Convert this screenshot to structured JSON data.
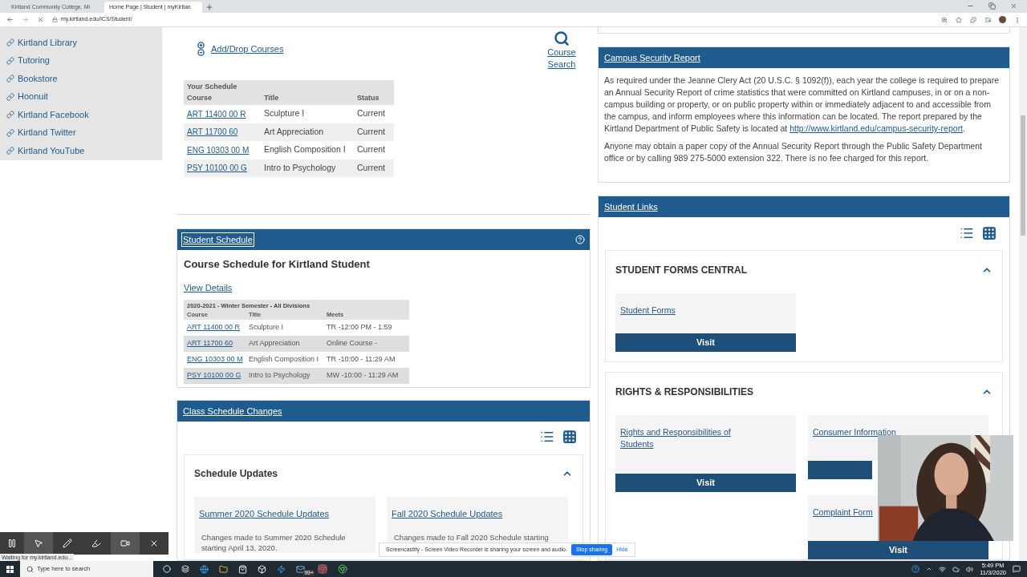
{
  "browser": {
    "tabs": [
      {
        "title": "Kirtland Community College, Mi",
        "selected": false
      },
      {
        "title": "Home Page | Student | myKirtlan",
        "selected": true
      }
    ],
    "url": "my.kirtland.edu/ICS/Student/"
  },
  "sidebar": {
    "links": [
      "Kirtland Library",
      "Tutoring",
      "Bookstore",
      "Hoonuit",
      "Kirtland Facebook",
      "Kirtland Twitter",
      "Kirtland YouTube"
    ]
  },
  "quick_links": {
    "add_drop": "Add/Drop Courses",
    "course_search": "Course Search"
  },
  "your_schedule": {
    "caption": "Your Schedule",
    "columns": [
      "Course",
      "Title",
      "Status"
    ],
    "rows": [
      {
        "course": "ART 11400 00 R",
        "title": "Sculpture I",
        "status": "Current"
      },
      {
        "course": "ART 11700 60",
        "title": "Art Appreciation",
        "status": "Current"
      },
      {
        "course": "ENG 10303 00 M",
        "title": "English Composition I",
        "status": "Current"
      },
      {
        "course": "PSY 10100 00 G",
        "title": "Intro to Psychology",
        "status": "Current"
      }
    ]
  },
  "student_schedule": {
    "header": "Student Schedule",
    "heading": "Course Schedule for Kirtland Student",
    "view_details": "View Details",
    "caption": "2020-2021 - Winter Semester - All Divisions",
    "columns": [
      "Course",
      "Title",
      "Meets"
    ],
    "rows": [
      {
        "course": "ART 11400 00 R",
        "title": "Sculpture I",
        "meets": "TR -12:00 PM - 1:59"
      },
      {
        "course": "ART 11700 60",
        "title": "Art Appreciation",
        "meets": "Online Course -"
      },
      {
        "course": "ENG 10303 00 M",
        "title": "English Composition I",
        "meets": "TR -10:00 - 11:29 AM"
      },
      {
        "course": "PSY 10100 00 G",
        "title": "Intro to Psychology",
        "meets": "MW -10:00 - 11:29 AM"
      }
    ]
  },
  "class_schedule_changes": {
    "header": "Class Schedule Changes",
    "section": {
      "title": "Schedule Updates",
      "expanded": true,
      "items": [
        {
          "link": "Summer 2020 Schedule Updates",
          "text": "Changes made to Summer 2020 Schedule starting April 13, 2020."
        },
        {
          "link": "Fall 2020 Schedule Updates",
          "text": "Changes made to Fall 2020 Schedule starting"
        }
      ]
    }
  },
  "campus_security": {
    "header": "Campus Security Report",
    "p1": "As required under the Jeanne Clery Act (20 U.S.C. § 1092(f)), each year the college is required to prepare an Annual Security Report of crime statistics that were committed on Kirtland campuses, in or on a non-campus building or property, or on public property within or immediately adjacent to and accessible from the campus, and inform employees where this information can be located. The report prepared by the Kirtland Department of Public Safety is located at ",
    "link": "http://www.kirtland.edu/campus-security-report",
    "p1_end": ".",
    "p2": "Anyone may obtain a paper copy of the Annual Security Report through the Public Safety Department office or by calling 989 275-5000 extension 322. There is no fee charged for this report."
  },
  "student_links": {
    "header": "Student Links",
    "sections": [
      {
        "title": "STUDENT FORMS CENTRAL",
        "expanded": true,
        "tiles": [
          {
            "link": "Student Forms",
            "button": "Visit"
          }
        ]
      },
      {
        "title": "RIGHTS & RESPONSIBILITIES",
        "expanded": true,
        "tiles": [
          {
            "link": "Rights and Responsibilities of Students",
            "button": "Visit"
          },
          {
            "link": "Consumer Information"
          },
          {
            "link": "Complaint Form",
            "button": "Visit"
          }
        ]
      }
    ]
  },
  "recorder": {
    "status": "Waiting for my.kirtland.edu...",
    "notice": "Screencastify - Screen Video Recorder is sharing your screen and audio.",
    "stop": "Stop sharing",
    "hide": "Hide"
  },
  "taskbar": {
    "search_placeholder": "Type here to search",
    "mail_badge": "99+",
    "time": "5:49 PM",
    "date": "11/3/2020"
  }
}
